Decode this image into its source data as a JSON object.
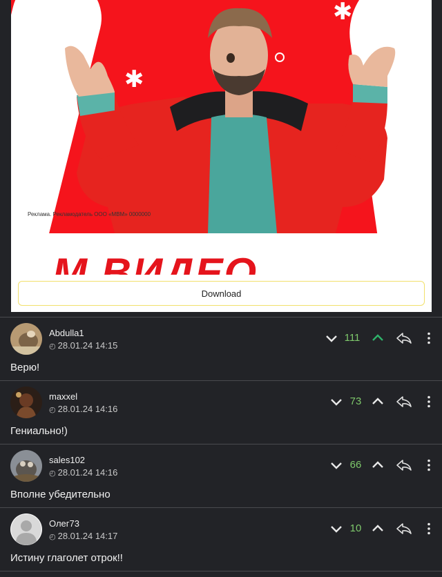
{
  "ad": {
    "disclaimer": "Реклама. Рекламодатель ООО «МВМ» 0000000",
    "logo_text": "М.ВИДЕО",
    "download_label": "Download"
  },
  "colors": {
    "upvote_active": "#2fb36a",
    "score_green": "#7ec86b",
    "ad_red": "#f5141c"
  },
  "comments": [
    {
      "user": "Abdulla1",
      "date": "28.01.24 14:15",
      "text": "Верю!",
      "score": "111",
      "upvoted": true,
      "avatar_icon": "camel-avatar"
    },
    {
      "user": "maxxel",
      "date": "28.01.24 14:16",
      "text": "Гениально!)",
      "score": "73",
      "upvoted": false,
      "avatar_icon": "figure-avatar"
    },
    {
      "user": "sales102",
      "date": "28.01.24 14:16",
      "text": "Вполне убедительно",
      "score": "66",
      "upvoted": false,
      "avatar_icon": "cat-avatar"
    },
    {
      "user": "Олег73",
      "date": "28.01.24 14:17",
      "text": "Истину глаголет отрок!!",
      "score": "10",
      "upvoted": false,
      "avatar_icon": "default-user-avatar"
    }
  ]
}
